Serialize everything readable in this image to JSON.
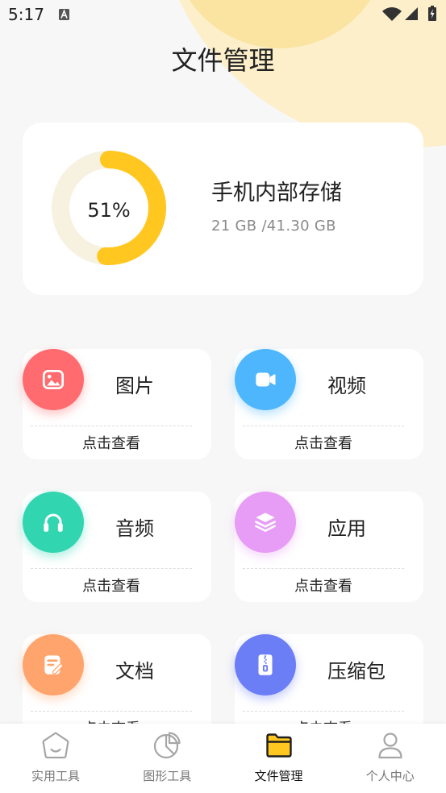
{
  "status_bar": {
    "time": "5:17",
    "icons": [
      "a-notification-icon",
      "wifi-icon",
      "signal-icon",
      "battery-charging-icon"
    ]
  },
  "page_title": "文件管理",
  "storage": {
    "ring_percent": 51,
    "percent_label": "51%",
    "title": "手机内部存储",
    "usage": "21 GB /41.30 GB",
    "ring_color": "#FFC71F",
    "track_color": "#F7F1E0"
  },
  "categories": [
    {
      "label": "图片",
      "action": "点击查看",
      "icon": "image-icon",
      "color": "#FF6B6E"
    },
    {
      "label": "视频",
      "action": "点击查看",
      "icon": "video-icon",
      "color": "#4EB6FC"
    },
    {
      "label": "音频",
      "action": "点击查看",
      "icon": "headphones-icon",
      "color": "#31D6B1"
    },
    {
      "label": "应用",
      "action": "点击查看",
      "icon": "layers-icon",
      "color": "#E79CF6"
    },
    {
      "label": "文档",
      "action": "点击查看",
      "icon": "document-edit-icon",
      "color": "#FFA46C"
    },
    {
      "label": "压缩包",
      "action": "点击查看",
      "icon": "zip-file-icon",
      "color": "#6C7EF5"
    }
  ],
  "bottom_nav": [
    {
      "label": "实用工具",
      "icon": "home-icon",
      "active": false
    },
    {
      "label": "图形工具",
      "icon": "pie-chart-icon",
      "active": false
    },
    {
      "label": "文件管理",
      "icon": "folder-icon",
      "active": true
    },
    {
      "label": "个人中心",
      "icon": "user-icon",
      "active": false
    }
  ],
  "theme": {
    "accent": "#FFC71F",
    "background": "#F7F7F7",
    "decor_light": "#FCEFC9",
    "decor_dark": "#FBE3A1"
  }
}
